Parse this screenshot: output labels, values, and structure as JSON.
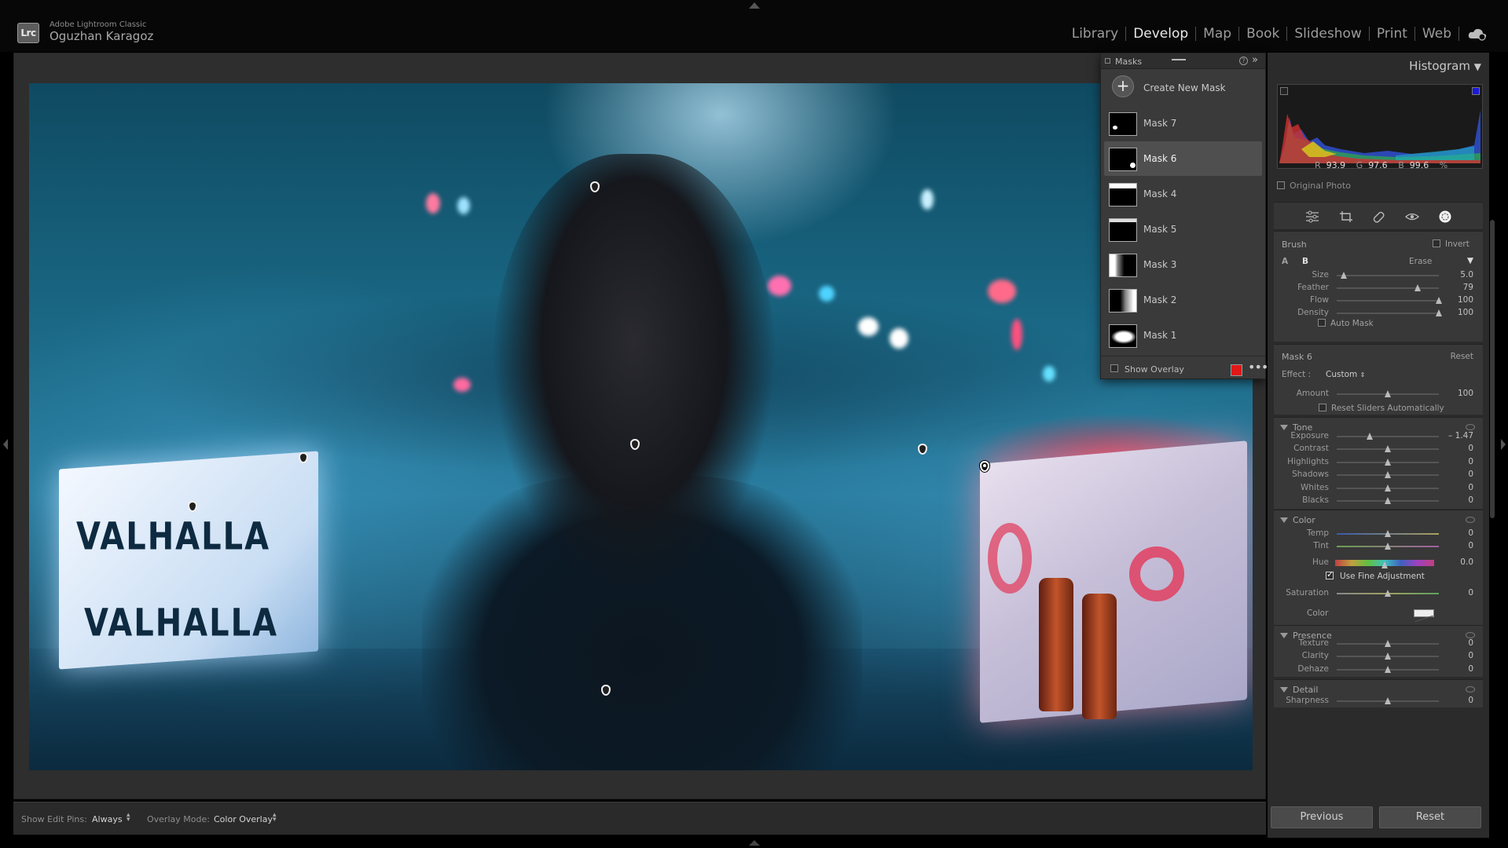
{
  "app": {
    "name": "Adobe Lightroom Classic",
    "logo": "Lrc",
    "user": "Oguzhan Karagoz"
  },
  "modules": [
    "Library",
    "Develop",
    "Map",
    "Book",
    "Slideshow",
    "Print",
    "Web"
  ],
  "active_module": "Develop",
  "masks": {
    "title": "Masks",
    "create_label": "Create New Mask",
    "items": [
      "Mask 7",
      "Mask 6",
      "Mask 4",
      "Mask 5",
      "Mask 3",
      "Mask 2",
      "Mask 1"
    ],
    "selected": "Mask 6",
    "show_overlay_label": "Show Overlay",
    "overlay_color": "#e01818"
  },
  "toolbar": {
    "edit_pins_label": "Show Edit Pins:",
    "edit_pins_value": "Always",
    "overlay_mode_label": "Overlay Mode:",
    "overlay_mode_value": "Color Overlay"
  },
  "histogram": {
    "title": "Histogram",
    "r_label": "R",
    "r_value": "93.9",
    "g_label": "G",
    "g_value": "97.6",
    "b_label": "B",
    "b_value": "99.6",
    "unit": "%",
    "original_photo_label": "Original Photo"
  },
  "brush": {
    "title": "Brush",
    "invert_label": "Invert",
    "a_label": "A",
    "b_label": "B",
    "erase_label": "Erase",
    "sliders": [
      {
        "label": "Size",
        "value": "5.0",
        "pos": 0.07
      },
      {
        "label": "Feather",
        "value": "79",
        "pos": 0.79
      },
      {
        "label": "Flow",
        "value": "100",
        "pos": 1.0
      },
      {
        "label": "Density",
        "value": "100",
        "pos": 1.0
      }
    ],
    "auto_mask_label": "Auto Mask"
  },
  "mask_settings": {
    "name": "Mask 6",
    "reset_label": "Reset",
    "effect_label": "Effect :",
    "effect_value": "Custom",
    "amount_label": "Amount",
    "amount_value": "100",
    "amount_pos": 0.5,
    "reset_sliders_label": "Reset Sliders Automatically"
  },
  "tone": {
    "title": "Tone",
    "sliders": [
      {
        "label": "Exposure",
        "value": "– 1.47",
        "pos": 0.32
      },
      {
        "label": "Contrast",
        "value": "0",
        "pos": 0.5
      },
      {
        "label": "Highlights",
        "value": "0",
        "pos": 0.5
      },
      {
        "label": "Shadows",
        "value": "0",
        "pos": 0.5
      },
      {
        "label": "Whites",
        "value": "0",
        "pos": 0.5
      },
      {
        "label": "Blacks",
        "value": "0",
        "pos": 0.5
      }
    ]
  },
  "color": {
    "title": "Color",
    "temp_label": "Temp",
    "temp_value": "0",
    "tint_label": "Tint",
    "tint_value": "0",
    "hue_label": "Hue",
    "hue_value": "0.0",
    "fine_adjust_label": "Use Fine Adjustment",
    "saturation_label": "Saturation",
    "saturation_value": "0",
    "color_label": "Color"
  },
  "presence": {
    "title": "Presence",
    "sliders": [
      {
        "label": "Texture",
        "value": "0",
        "pos": 0.5
      },
      {
        "label": "Clarity",
        "value": "0",
        "pos": 0.5
      },
      {
        "label": "Dehaze",
        "value": "0",
        "pos": 0.5
      }
    ]
  },
  "detail": {
    "title": "Detail",
    "sharpness_label": "Sharpness",
    "sharpness_value": "0"
  },
  "buttons": {
    "previous": "Previous",
    "reset": "Reset"
  },
  "photo_text": {
    "left_cube": "VALHALLA"
  }
}
